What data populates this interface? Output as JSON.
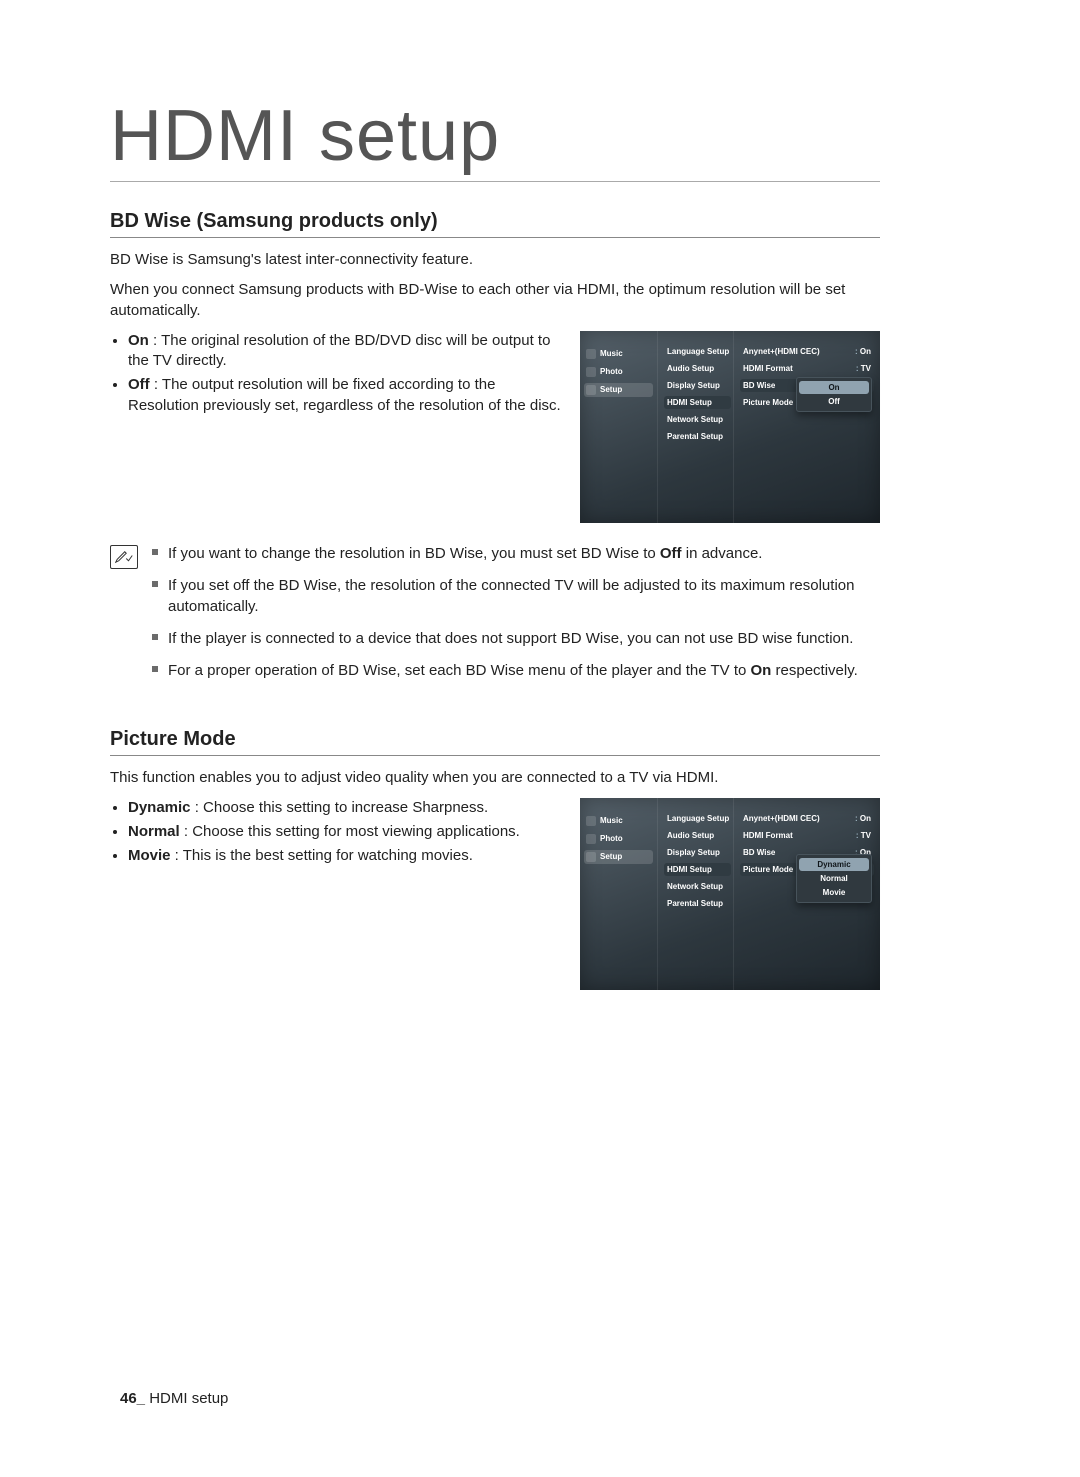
{
  "page": {
    "title": "HDMI setup",
    "footer_page": "46_",
    "footer_text": "HDMI setup"
  },
  "bdwise": {
    "heading": "BD Wise (Samsung products only)",
    "intro1": "BD Wise is Samsung's latest inter-connectivity feature.",
    "intro2": "When you connect Samsung products with BD-Wise to each other via HDMI, the optimum resolution will be set automatically.",
    "items": [
      {
        "lead": "On",
        "rest": " : The original resolution of the BD/DVD disc will be output to the TV directly."
      },
      {
        "lead": "Off",
        "rest": " : The output resolution will be fixed according to the Resolution previously set, regardless of the resolution of the disc."
      }
    ],
    "notes": [
      "If you want to change the resolution in BD Wise, you must set BD Wise to Off in advance.",
      "If you set off the BD Wise, the resolution of the connected TV will be adjusted to its maximum resolution automatically.",
      "If the player is connected to a device that does not support BD Wise, you can not use BD wise function.",
      "For a proper operation of BD Wise, set each BD Wise menu of the player and the TV to On respectively."
    ]
  },
  "picture": {
    "heading": "Picture Mode",
    "intro": "This function enables you to adjust video quality when you are connected to a TV via HDMI.",
    "items": [
      {
        "lead": "Dynamic",
        "rest": " : Choose this setting to increase Sharpness."
      },
      {
        "lead": "Normal",
        "rest": " : Choose this setting for most viewing applications."
      },
      {
        "lead": "Movie",
        "rest": " : This is the best setting for watching movies."
      }
    ]
  },
  "osd": {
    "nav": [
      "Music",
      "Photo",
      "Setup"
    ],
    "mid": [
      "Language Setup",
      "Audio Setup",
      "Display Setup",
      "HDMI Setup",
      "Network Setup",
      "Parental Setup"
    ],
    "right1": [
      {
        "label": "Anynet+(HDMI CEC)",
        "value": "On"
      },
      {
        "label": "HDMI Format",
        "value": "TV"
      },
      {
        "label": "BD Wise",
        "value": ":"
      },
      {
        "label": "Picture Mode",
        "value": ""
      }
    ],
    "drop1": [
      "On",
      "Off"
    ],
    "right2": [
      {
        "label": "Anynet+(HDMI CEC)",
        "value": "On"
      },
      {
        "label": "HDMI Format",
        "value": "TV"
      },
      {
        "label": "BD Wise",
        "value": "On"
      },
      {
        "label": "Picture Mode",
        "value": ":"
      }
    ],
    "drop2": [
      "Dynamic",
      "Normal",
      "Movie"
    ]
  }
}
